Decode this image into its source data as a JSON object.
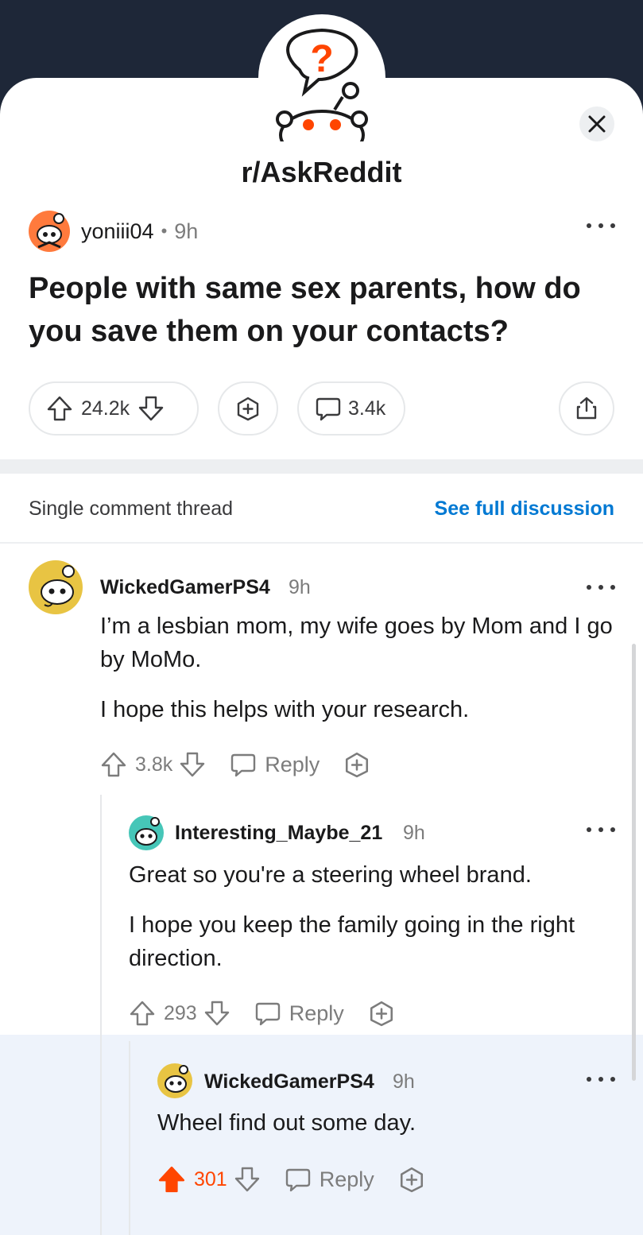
{
  "subreddit": {
    "name": "r/AskReddit",
    "icon": "question-bubble-snoo-icon"
  },
  "post": {
    "author": "yoniii04",
    "separator": "•",
    "age": "9h",
    "title": "People with same sex parents, how do you save them on your contacts?",
    "upvotes": "24.2k",
    "comments": "3.4k"
  },
  "thread": {
    "label": "Single comment thread",
    "link": "See full discussion"
  },
  "comments": [
    {
      "author": "WickedGamerPS4",
      "age": "9h",
      "paragraphs": [
        "I’m a lesbian mom, my wife goes by Mom and I go by MoMo.",
        "I hope this helps with your research."
      ],
      "votes": "3.8k",
      "reply_label": "Reply"
    },
    {
      "author": "Interesting_Maybe_21",
      "age": "9h",
      "paragraphs": [
        "Great so you're a steering wheel brand.",
        "I hope you keep the family going in the right direction."
      ],
      "votes": "293",
      "reply_label": "Reply"
    },
    {
      "author": "WickedGamerPS4",
      "age": "9h",
      "paragraphs": [
        "Wheel find out some day."
      ],
      "votes": "301",
      "reply_label": "Reply",
      "upvoted": true
    }
  ],
  "colors": {
    "upvote": "#ff4500",
    "link": "#0079d3",
    "backdrop": "#1e2738"
  }
}
